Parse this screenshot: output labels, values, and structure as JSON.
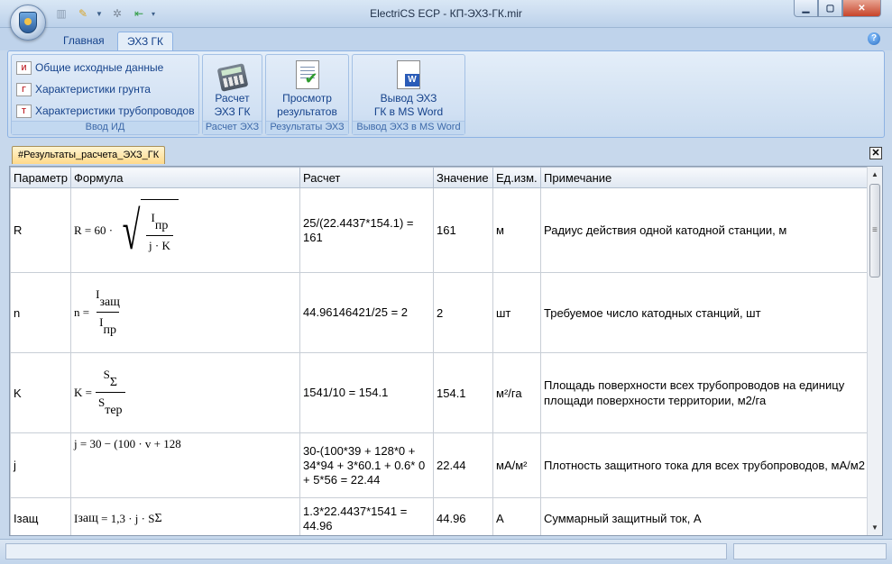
{
  "window": {
    "title": "ElectriCS ECP - КП-ЭХЗ-ГК.mir"
  },
  "ribbon": {
    "tabs": [
      {
        "label": "Главная",
        "active": false
      },
      {
        "label": "ЭХЗ ГК",
        "active": true
      }
    ],
    "groups": {
      "input": {
        "label": "Ввод ИД",
        "items": [
          {
            "label": "Общие исходные данные",
            "icon": "input-data-icon"
          },
          {
            "label": "Характеристики грунта",
            "icon": "soil-icon"
          },
          {
            "label": "Характеристики трубопроводов",
            "icon": "pipeline-icon"
          }
        ]
      },
      "calc": {
        "label": "Расчет ЭХЗ",
        "button_line1": "Расчет",
        "button_line2": "ЭХЗ ГК",
        "icon": "calculator-icon"
      },
      "results": {
        "label": "Результаты ЭХЗ",
        "button_line1": "Просмотр",
        "button_line2": "результатов",
        "icon": "results-doc-icon"
      },
      "word": {
        "label": "Вывод ЭХЗ в MS Word",
        "button_line1": "Вывод ЭХЗ",
        "button_line2": "ГК в MS Word",
        "icon": "word-doc-icon"
      }
    }
  },
  "document": {
    "tab_label": "#Результаты_расчета_ЭХЗ_ГК"
  },
  "grid": {
    "columns": [
      "Параметр",
      "Формула",
      "Расчет",
      "Значение",
      "Ед.изм.",
      "Примечание"
    ],
    "rows": [
      {
        "param": "R",
        "calc": "25/(22.4437*154.1) = 161",
        "value": "161",
        "unit": "м",
        "note": "Радиус действия одной катодной станции, м"
      },
      {
        "param": "n",
        "calc": "44.96146421/25 = 2",
        "value": "2",
        "unit": "шт",
        "note": "Требуемое число катодных станций, шт"
      },
      {
        "param": "K",
        "calc": "1541/10 = 154.1",
        "value": "154.1",
        "unit": "м²/га",
        "note": "Площадь поверхности всех трубопроводов на единицу площади поверхности территории, м2/га"
      },
      {
        "param": "j",
        "calc": "30-(100*39 + 128*0 + 34*94 + 3*60.1 + 0.6* 0 + 5*56 = 22.44",
        "value": "22.44",
        "unit": "мА/м²",
        "note": "Плотность защитного тока для всех трубопроводов, мА/м2"
      },
      {
        "param": "Iзащ",
        "calc": "1.3*22.4437*1541 = 44.96",
        "value": "44.96",
        "unit": "А",
        "note": "Суммарный защитный ток,  А"
      }
    ],
    "formulas": {
      "R": {
        "lhs": "R",
        "eq": "=",
        "coef": "60",
        "dot": "·",
        "num": "I",
        "num_sub": "пр",
        "den": "j · K"
      },
      "n": {
        "lhs": "n",
        "eq": "=",
        "num": "I",
        "num_sub": "защ",
        "den": "I",
        "den_sub": "пр"
      },
      "K": {
        "lhs": "K",
        "eq": "=",
        "num": "S",
        "num_sub": "Σ",
        "den": "S",
        "den_sub": "тер"
      },
      "j": {
        "text": "j = 30 − (100 · v + 128"
      },
      "I": {
        "lhs": "I",
        "lhs_sub": "защ",
        "rhs": "= 1,3 · j · S",
        "rhs_sub": "Σ"
      }
    }
  }
}
